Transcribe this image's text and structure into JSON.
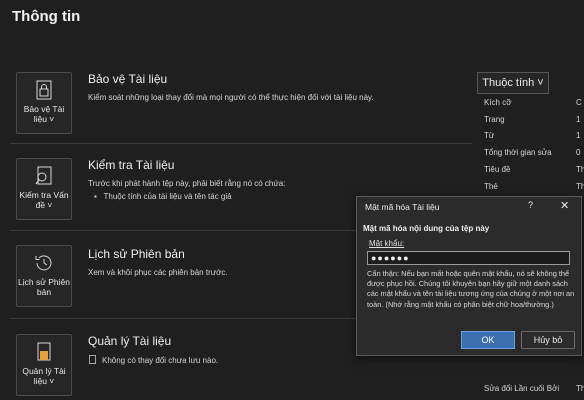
{
  "page_title": "Thông tin",
  "tiles": {
    "protect": "Bảo vệ Tài liệu ˅",
    "inspect": "Kiểm tra Vấn đề ˅",
    "history": "Lịch sử Phiên bản",
    "manage": "Quản lý Tài liệu ˅"
  },
  "sections": {
    "protect": {
      "heading": "Bảo vệ Tài liệu",
      "desc": "Kiểm soát những loại thay đổi mà mọi người có thể thực hiện đối với tài liệu này."
    },
    "inspect": {
      "heading": "Kiểm tra Tài liệu",
      "desc": "Trước khi phát hành tệp này, phải biết rằng nó có chứa:",
      "bullet": "Thuộc tính của tài liệu và tên tác giả"
    },
    "history": {
      "heading": "Lịch sử Phiên bản",
      "desc": "Xem và khôi phục các phiên bản trước."
    },
    "manage": {
      "heading": "Quản lý Tài liệu",
      "desc": "Không có thay đổi chưa lưu nào."
    }
  },
  "properties": {
    "button": "Thuộc tính ˅",
    "rows": [
      "Kích cỡ",
      "Trang",
      "Từ",
      "Tổng thời gian sửa",
      "Tiêu đề",
      "Thẻ"
    ],
    "values": [
      "C",
      "1",
      "1",
      "0",
      "Th",
      "Th"
    ],
    "last_modified": "Sửa đổi Lần cuối Bởi",
    "last_modified_value": "Th"
  },
  "dialog": {
    "title": "Mật mã hóa Tài liệu",
    "help": "?",
    "close": "✕",
    "heading": "Mật mã hóa nội dung của tệp này",
    "label": "Mật khẩu:",
    "password": "●●●●●●",
    "warning": "Cẩn thận: Nếu bạn mất hoặc quên mật khẩu, nó sẽ không thể được phục hồi. Chúng tôi khuyên bạn hãy giữ một danh sách các mật khẩu và tên tài liệu tương ứng của chúng ở một nơi an toàn. (Nhớ rằng mật khẩu có phân biệt chữ hoa/thường.)",
    "ok": "OK",
    "cancel": "Hủy bỏ"
  }
}
